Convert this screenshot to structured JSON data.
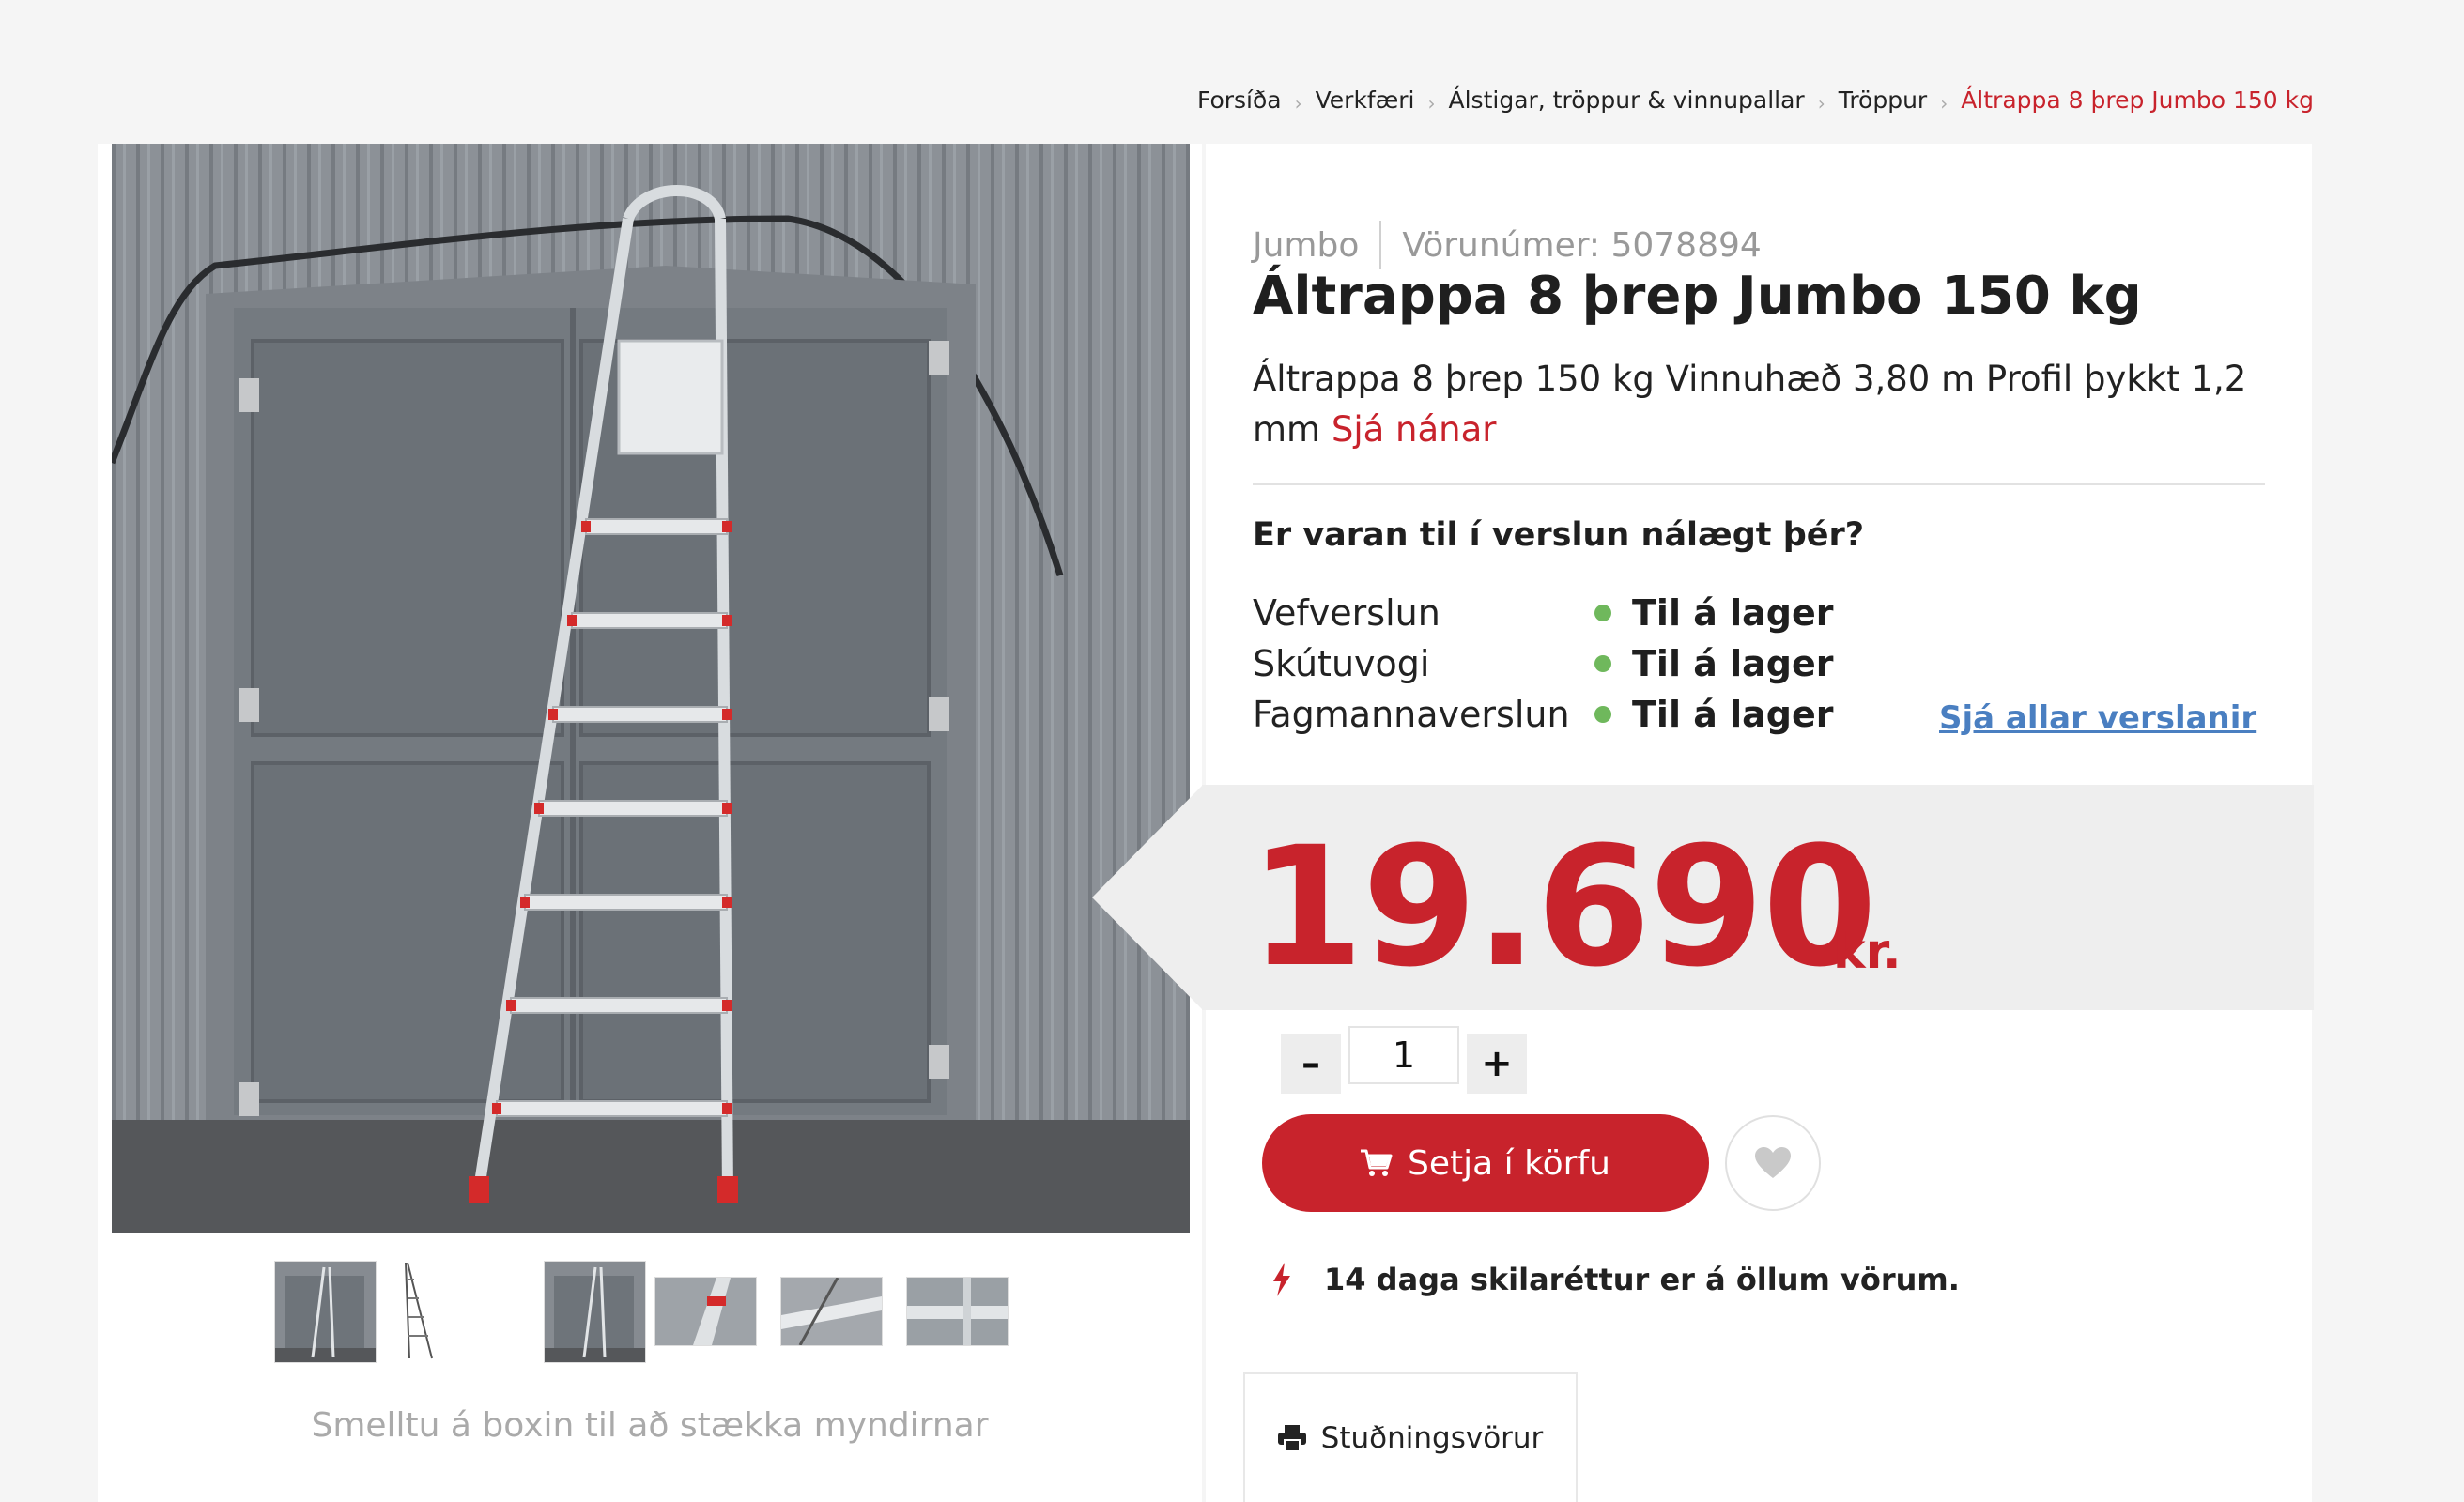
{
  "breadcrumb": [
    {
      "label": "Forsíða"
    },
    {
      "label": "Verkfæri"
    },
    {
      "label": "Álstigar, tröppur & vinnupallar"
    },
    {
      "label": "Tröppur"
    },
    {
      "label": "Áltrappa 8 þrep Jumbo 150 kg"
    }
  ],
  "gallery": {
    "main_image": "ladder-photo",
    "thumbnails": [
      "ladder-front-photo",
      "ladder-side-drawing",
      "ladder-front-photo-2",
      "ladder-top-closeup",
      "ladder-step-closeup",
      "ladder-detail-closeup"
    ],
    "hint": "Smelltu á boxin til að stækka myndirnar"
  },
  "product": {
    "brand": "Jumbo",
    "sku_label": "Vörunúmer: 5078894",
    "title": "Áltrappa 8 þrep Jumbo 150 kg",
    "description": "Áltrappa 8 þrep 150 kg Vinnuhæð 3,80 m Profil þykkt 1,2 mm",
    "more_link": "Sjá nánar"
  },
  "availability": {
    "question": "Er varan til í verslun nálægt þér?",
    "stores": [
      {
        "name": "Vefverslun",
        "status": "Til á lager"
      },
      {
        "name": "Skútuvogi",
        "status": "Til á lager"
      },
      {
        "name": "Fagmannaverslun",
        "status": "Til á lager"
      }
    ],
    "status_color": "#6fb85c",
    "all_stores_link": "Sjá allar verslanir"
  },
  "price": {
    "amount": "19.690",
    "currency": "kr."
  },
  "quantity": {
    "minus": "–",
    "value": "1",
    "plus": "+"
  },
  "actions": {
    "add_to_cart": "Setja í körfu",
    "wishlist_icon": "heart-icon"
  },
  "returns_note": "14 daga skilaréttur er á öllum vörum.",
  "tabs": [
    {
      "label": "Stuðningsvörur",
      "icon": "printer-icon"
    }
  ],
  "colors": {
    "accent": "#c8232c",
    "link": "#4a7fc1",
    "in_stock": "#6fb85c"
  }
}
